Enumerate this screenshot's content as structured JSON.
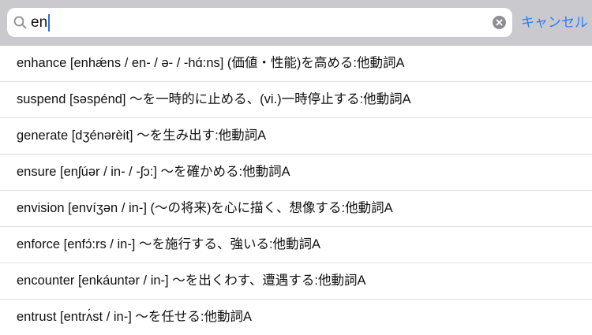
{
  "search": {
    "query": "en",
    "cancel_label": "キャンセル"
  },
  "icons": {
    "search": "search-icon",
    "clear": "clear-icon"
  },
  "colors": {
    "accent": "#2f7cf6",
    "search_bar_bg": "#c9c9ce",
    "clear_icon": "#8e8e93",
    "separator": "#dedee2"
  },
  "results": [
    {
      "text": "enhance [enhǽns / en- / ə- / -hɑ́:ns] (価値・性能)を高める:他動詞A"
    },
    {
      "text": "suspend [səspénd] 〜を一時的に止める、(vi.)一時停止する:他動詞A"
    },
    {
      "text": "generate [dʒénərèit] 〜を生み出す:他動詞A"
    },
    {
      "text": "ensure [enʃúər / in- / -ʃɔ:] 〜を確かめる:他動詞A"
    },
    {
      "text": "envision [envíʒən / in-] (〜の将来)を心に描く、想像する:他動詞A"
    },
    {
      "text": "enforce [enfɔ́:rs / in-] 〜を施行する、強いる:他動詞A"
    },
    {
      "text": "encounter [enkáuntər / in-] 〜を出くわす、遭遇する:他動詞A"
    },
    {
      "text": "entrust [entrʌ́st / in-] 〜を任せる:他動詞A"
    }
  ]
}
